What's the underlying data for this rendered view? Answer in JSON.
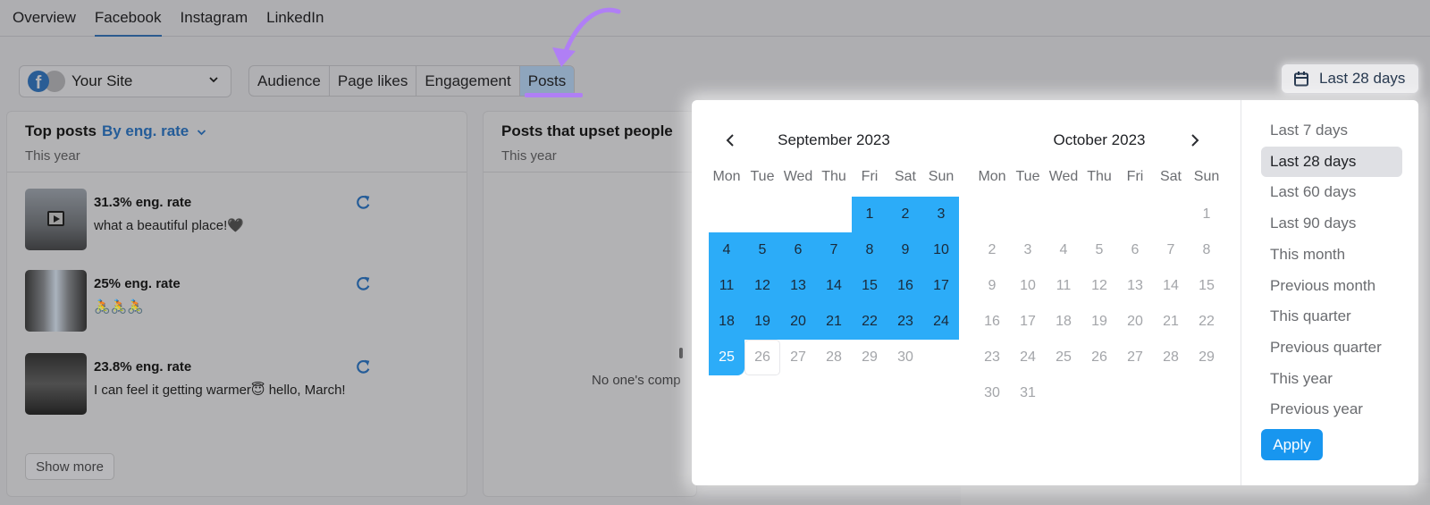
{
  "topnav": {
    "tabs": [
      {
        "label": "Overview",
        "active": false
      },
      {
        "label": "Facebook",
        "active": true
      },
      {
        "label": "Instagram",
        "active": false
      },
      {
        "label": "LinkedIn",
        "active": false
      }
    ]
  },
  "site_select": {
    "value": "Your Site",
    "icon": "facebook-icon"
  },
  "segments": [
    {
      "label": "Audience",
      "active": false
    },
    {
      "label": "Page likes",
      "active": false
    },
    {
      "label": "Engagement",
      "active": false
    },
    {
      "label": "Posts",
      "active": true
    }
  ],
  "annotation": {
    "arrow_color": "#b07ff5",
    "highlight": "Posts"
  },
  "top_posts": {
    "title": "Top posts",
    "sort_label": "By eng. rate",
    "period": "This year",
    "posts": [
      {
        "rate": "31.3% eng. rate",
        "text": "what a beautiful place!🖤",
        "has_video": true
      },
      {
        "rate": "25% eng. rate",
        "text": "🚴🚴🚴",
        "has_video": false
      },
      {
        "rate": "23.8% eng. rate",
        "text": "I can feel it getting warmer😇 hello, March!",
        "has_video": false
      }
    ],
    "show_more_label": "Show more"
  },
  "upset_posts": {
    "title": "Posts that upset people",
    "period": "This year",
    "empty_text": "No one's comp"
  },
  "date_button": {
    "label": "Last 28 days"
  },
  "date_picker": {
    "weekdays": [
      "Mon",
      "Tue",
      "Wed",
      "Thu",
      "Fri",
      "Sat",
      "Sun"
    ],
    "months": [
      {
        "title": "September 2023",
        "first_weekday": 4,
        "days": 30
      },
      {
        "title": "October 2023",
        "first_weekday": 6,
        "days": 31
      }
    ],
    "range": {
      "start": "2023-09-01",
      "end": "2023-09-25"
    },
    "today": "2023-09-26",
    "presets": [
      {
        "label": "Last 7 days",
        "active": false
      },
      {
        "label": "Last 28 days",
        "active": true
      },
      {
        "label": "Last 60 days",
        "active": false
      },
      {
        "label": "Last 90 days",
        "active": false
      },
      {
        "label": "This month",
        "active": false
      },
      {
        "label": "Previous month",
        "active": false
      },
      {
        "label": "This quarter",
        "active": false
      },
      {
        "label": "Previous quarter",
        "active": false
      },
      {
        "label": "This year",
        "active": false
      },
      {
        "label": "Previous year",
        "active": false
      }
    ],
    "apply_label": "Apply",
    "colors": {
      "range": "#2cacf8",
      "apply": "#1896ef"
    }
  }
}
